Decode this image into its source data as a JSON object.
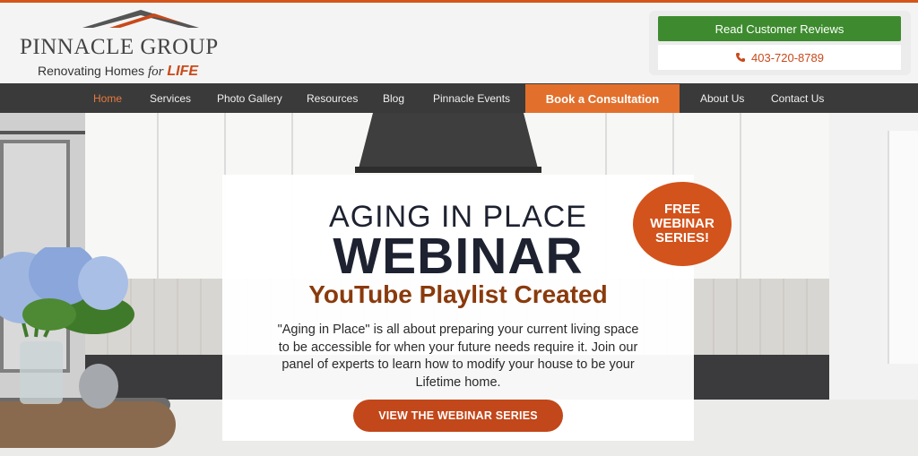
{
  "header": {
    "logo_name": "PINNACLE GROUP",
    "logo_tag_main": "Renovating Homes",
    "logo_tag_for": "for",
    "logo_tag_life": "LIFE",
    "reviews_label": "Read Customer Reviews",
    "phone": "403-720-8789"
  },
  "nav": {
    "items": [
      {
        "label": "Home"
      },
      {
        "label": "Services"
      },
      {
        "label": "Photo Gallery"
      },
      {
        "label": "Resources"
      },
      {
        "label": "Blog"
      },
      {
        "label": "Pinnacle Events"
      },
      {
        "label": "Book a Consultation"
      },
      {
        "label": "About Us"
      },
      {
        "label": "Contact Us"
      }
    ],
    "active": "Home"
  },
  "hero": {
    "heading_line1": "AGING IN PLACE",
    "heading_line2": "WEBINAR",
    "subheading": "YouTube Playlist Created",
    "body": "\"Aging in Place\" is all about preparing your current living space to be accessible for when your future needs require it. Join our panel of experts to learn how to modify your house to be your Lifetime home.",
    "button_label": "VIEW THE WEBINAR SERIES",
    "badge_line1": "FREE",
    "badge_line2": "WEBINAR",
    "badge_line3": "SERIES!"
  },
  "colors": {
    "accent": "#e2702c",
    "green": "#3d8b2e",
    "dark_nav": "#3a3a3a",
    "heading": "#1e2230",
    "subheading": "#8a3a0c"
  },
  "icons": {
    "phone": "phone-icon",
    "logo_roof": "roof-icon"
  }
}
